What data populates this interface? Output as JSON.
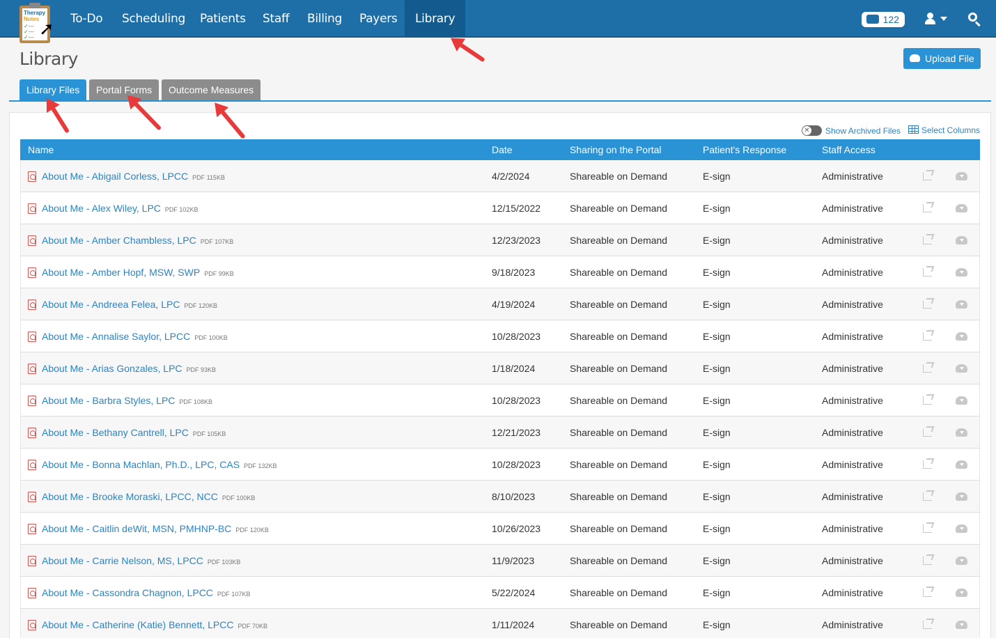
{
  "navbar": {
    "logo": {
      "line1": "Therapy",
      "line2": "Notes",
      "checks": "✓—\n✓—\n✓—"
    },
    "items": [
      {
        "label": "To-Do"
      },
      {
        "label": "Scheduling"
      },
      {
        "label": "Patients"
      },
      {
        "label": "Staff"
      },
      {
        "label": "Billing"
      },
      {
        "label": "Payers"
      },
      {
        "label": "Library",
        "active": true
      }
    ],
    "messages_count": "122"
  },
  "page": {
    "title": "Library",
    "upload_label": "Upload File"
  },
  "tabs": [
    {
      "label": "Library Files",
      "active": true
    },
    {
      "label": "Portal Forms"
    },
    {
      "label": "Outcome Measures"
    }
  ],
  "toolbar": {
    "archived_label": "Show Archived Files",
    "archived_enabled": false,
    "columns_label": "Select Columns"
  },
  "table": {
    "headers": [
      "Name",
      "Date",
      "Sharing on the Portal",
      "Patient's Response",
      "Staff Access"
    ],
    "rows": [
      {
        "name": "About Me - Abigail Corless, LPCC",
        "meta": "PDF 115KB",
        "date": "4/2/2024",
        "sharing": "Shareable on Demand",
        "response": "E-sign",
        "access": "Administrative"
      },
      {
        "name": "About Me - Alex Wiley, LPC",
        "meta": "PDF 102KB",
        "date": "12/15/2022",
        "sharing": "Shareable on Demand",
        "response": "E-sign",
        "access": "Administrative"
      },
      {
        "name": "About Me - Amber Chambless, LPC",
        "meta": "PDF 107KB",
        "date": "12/23/2023",
        "sharing": "Shareable on Demand",
        "response": "E-sign",
        "access": "Administrative"
      },
      {
        "name": "About Me - Amber Hopf, MSW, SWP",
        "meta": "PDF 99KB",
        "date": "9/18/2023",
        "sharing": "Shareable on Demand",
        "response": "E-sign",
        "access": "Administrative"
      },
      {
        "name": "About Me - Andreea Felea, LPC",
        "meta": "PDF 120KB",
        "date": "4/19/2024",
        "sharing": "Shareable on Demand",
        "response": "E-sign",
        "access": "Administrative"
      },
      {
        "name": "About Me - Annalise Saylor, LPCC",
        "meta": "PDF 100KB",
        "date": "10/28/2023",
        "sharing": "Shareable on Demand",
        "response": "E-sign",
        "access": "Administrative"
      },
      {
        "name": "About Me - Arias Gonzales, LPC",
        "meta": "PDF 93KB",
        "date": "1/18/2024",
        "sharing": "Shareable on Demand",
        "response": "E-sign",
        "access": "Administrative"
      },
      {
        "name": "About Me - Barbra Styles, LPC",
        "meta": "PDF 108KB",
        "date": "10/28/2023",
        "sharing": "Shareable on Demand",
        "response": "E-sign",
        "access": "Administrative"
      },
      {
        "name": "About Me - Bethany Cantrell, LPC",
        "meta": "PDF 105KB",
        "date": "12/21/2023",
        "sharing": "Shareable on Demand",
        "response": "E-sign",
        "access": "Administrative"
      },
      {
        "name": "About Me - Bonna Machlan, Ph.D., LPC, CAS",
        "meta": "PDF 132KB",
        "date": "10/28/2023",
        "sharing": "Shareable on Demand",
        "response": "E-sign",
        "access": "Administrative"
      },
      {
        "name": "About Me - Brooke Moraski, LPCC, NCC",
        "meta": "PDF 100KB",
        "date": "8/10/2023",
        "sharing": "Shareable on Demand",
        "response": "E-sign",
        "access": "Administrative"
      },
      {
        "name": "About Me - Caitlin deWit, MSN, PMHNP-BC",
        "meta": "PDF 120KB",
        "date": "10/26/2023",
        "sharing": "Shareable on Demand",
        "response": "E-sign",
        "access": "Administrative"
      },
      {
        "name": "About Me - Carrie Nelson, MS, LPCC",
        "meta": "PDF 103KB",
        "date": "11/9/2023",
        "sharing": "Shareable on Demand",
        "response": "E-sign",
        "access": "Administrative"
      },
      {
        "name": "About Me - Cassondra Chagnon, LPCC",
        "meta": "PDF 107KB",
        "date": "5/22/2024",
        "sharing": "Shareable on Demand",
        "response": "E-sign",
        "access": "Administrative"
      },
      {
        "name": "About Me - Catherine (Katie) Bennett, LPCC",
        "meta": "PDF 70KB",
        "date": "1/11/2024",
        "sharing": "Shareable on Demand",
        "response": "E-sign",
        "access": "Administrative"
      }
    ]
  },
  "colors": {
    "navbar": "#1e6fa8",
    "accent": "#2a93d5",
    "link": "#2a84c4",
    "annotation": "#e83a3a"
  }
}
